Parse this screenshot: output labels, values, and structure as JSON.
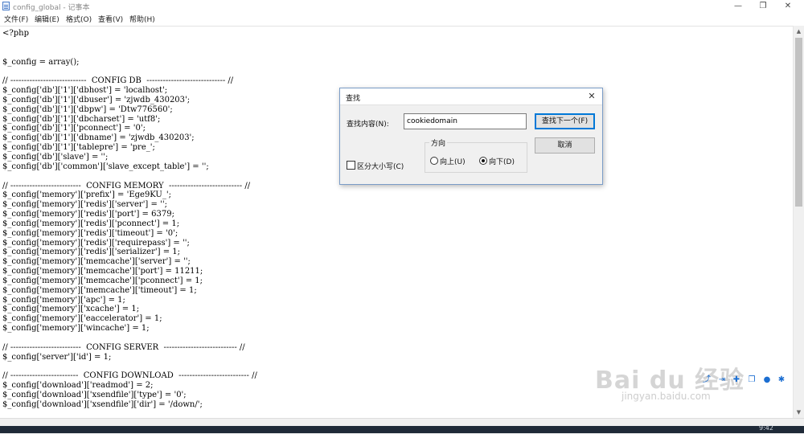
{
  "window": {
    "title": "config_global - 记事本",
    "controls": {
      "minimize": "—",
      "maximize": "❐",
      "close": "✕"
    }
  },
  "menu": {
    "items": [
      {
        "label": "文件(F)"
      },
      {
        "label": "编辑(E)"
      },
      {
        "label": "格式(O)"
      },
      {
        "label": "查看(V)"
      },
      {
        "label": "帮助(H)"
      }
    ]
  },
  "editor": {
    "lines": [
      "<?php",
      "",
      "",
      "$_config = array();",
      "",
      "// ----------------------------  CONFIG DB  ----------------------------- //",
      "$_config['db']['1']['dbhost'] = 'localhost';",
      "$_config['db']['1']['dbuser'] = 'zjwdb_430203';",
      "$_config['db']['1']['dbpw'] = 'Dtw776560';",
      "$_config['db']['1']['dbcharset'] = 'utf8';",
      "$_config['db']['1']['pconnect'] = '0';",
      "$_config['db']['1']['dbname'] = 'zjwdb_430203';",
      "$_config['db']['1']['tablepre'] = 'pre_';",
      "$_config['db']['slave'] = '';",
      "$_config['db']['common']['slave_except_table'] = '';",
      "",
      "// --------------------------  CONFIG MEMORY  --------------------------- //",
      "$_config['memory']['prefix'] = 'Ege9KU_';",
      "$_config['memory']['redis']['server'] = '';",
      "$_config['memory']['redis']['port'] = 6379;",
      "$_config['memory']['redis']['pconnect'] = 1;",
      "$_config['memory']['redis']['timeout'] = '0';",
      "$_config['memory']['redis']['requirepass'] = '';",
      "$_config['memory']['redis']['serializer'] = 1;",
      "$_config['memory']['memcache']['server'] = '';",
      "$_config['memory']['memcache']['port'] = 11211;",
      "$_config['memory']['memcache']['pconnect'] = 1;",
      "$_config['memory']['memcache']['timeout'] = 1;",
      "$_config['memory']['apc'] = 1;",
      "$_config['memory']['xcache'] = 1;",
      "$_config['memory']['eaccelerator'] = 1;",
      "$_config['memory']['wincache'] = 1;",
      "",
      "// --------------------------  CONFIG SERVER  --------------------------- //",
      "$_config['server']['id'] = 1;",
      "",
      "// -------------------------  CONFIG DOWNLOAD  -------------------------- //",
      "$_config['download']['readmod'] = 2;",
      "$_config['download']['xsendfile']['type'] = '0';",
      "$_config['download']['xsendfile']['dir'] = '/down/';"
    ]
  },
  "find_dialog": {
    "title": "查找",
    "close": "✕",
    "find_label": "查找内容(N):",
    "find_value": "cookiedomain",
    "find_next_label": "查找下一个(F)",
    "cancel_label": "取消",
    "direction_label": "方向",
    "up_label": "向上(U)",
    "down_label": "向下(D)",
    "direction_selected": "down",
    "match_case_label": "区分大小写(C)",
    "match_case_checked": false
  },
  "watermark": {
    "logo": "Bai du 经验",
    "url": "jingyan.baidu.com"
  },
  "status": {
    "clock": "9:42"
  },
  "icons": [
    "notepad-icon",
    "share-icon",
    "send-icon",
    "favorite-icon",
    "user-icon",
    "settings-icon"
  ]
}
